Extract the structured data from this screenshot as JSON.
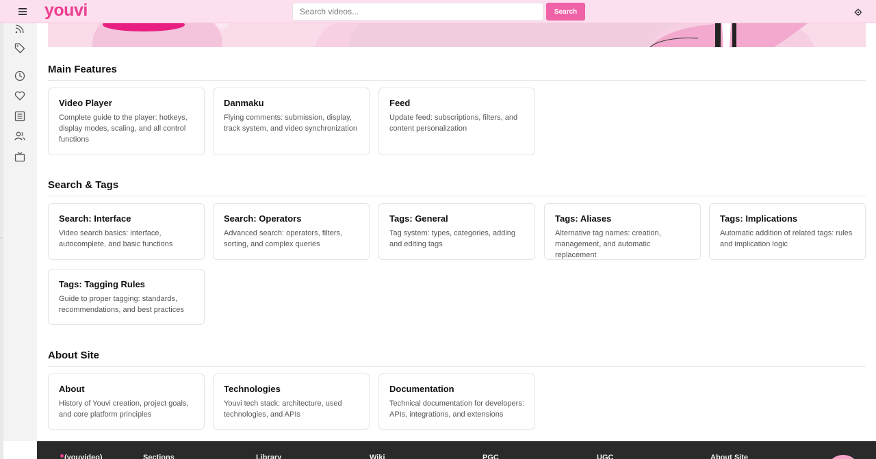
{
  "header": {
    "logo": "youvi",
    "search_placeholder": "Search videos...",
    "search_button": "Search"
  },
  "sidebar": {
    "icons": [
      "rss-icon",
      "tag-icon",
      "clock-icon",
      "heart-icon",
      "list-icon",
      "users-icon",
      "tv-icon"
    ]
  },
  "sections": {
    "main": {
      "title": "Main Features",
      "cards": [
        {
          "title": "Video Player",
          "desc": "Complete guide to the player: hotkeys, display modes, scaling, and all control functions"
        },
        {
          "title": "Danmaku",
          "desc": "Flying comments: submission, display, track system, and video synchronization"
        },
        {
          "title": "Feed",
          "desc": "Update feed: subscriptions, filters, and content personalization"
        }
      ]
    },
    "search": {
      "title": "Search & Tags",
      "cards": [
        {
          "title": "Search: Interface",
          "desc": "Video search basics: interface, autocomplete, and basic functions"
        },
        {
          "title": "Search: Operators",
          "desc": "Advanced search: operators, filters, sorting, and complex queries"
        },
        {
          "title": "Tags: General",
          "desc": "Tag system: types, categories, adding and editing tags"
        },
        {
          "title": "Tags: Aliases",
          "desc": "Alternative tag names: creation, management, and automatic replacement"
        },
        {
          "title": "Tags: Implications",
          "desc": "Automatic addition of related tags: rules and implication logic"
        },
        {
          "title": "Tags: Tagging Rules",
          "desc": "Guide to proper tagging: standards, recommendations, and best practices"
        }
      ]
    },
    "about": {
      "title": "About Site",
      "cards": [
        {
          "title": "About",
          "desc": "History of Youvi creation, project goals, and core platform principles"
        },
        {
          "title": "Technologies",
          "desc": "Youvi tech stack: architecture, used technologies, and APIs"
        },
        {
          "title": "Documentation",
          "desc": "Technical documentation for developers: APIs, integrations, and extensions"
        }
      ]
    }
  },
  "footer": {
    "brand": "(youvideo)",
    "columns": [
      "Sections",
      "Library",
      "Wiki",
      "PGC",
      "UGC",
      "About Site"
    ]
  },
  "colors": {
    "accent": "#ec3f8f",
    "header_bg": "#fde0ef",
    "search_button": "#f062a7",
    "footer_bg": "#2a2a2a"
  }
}
